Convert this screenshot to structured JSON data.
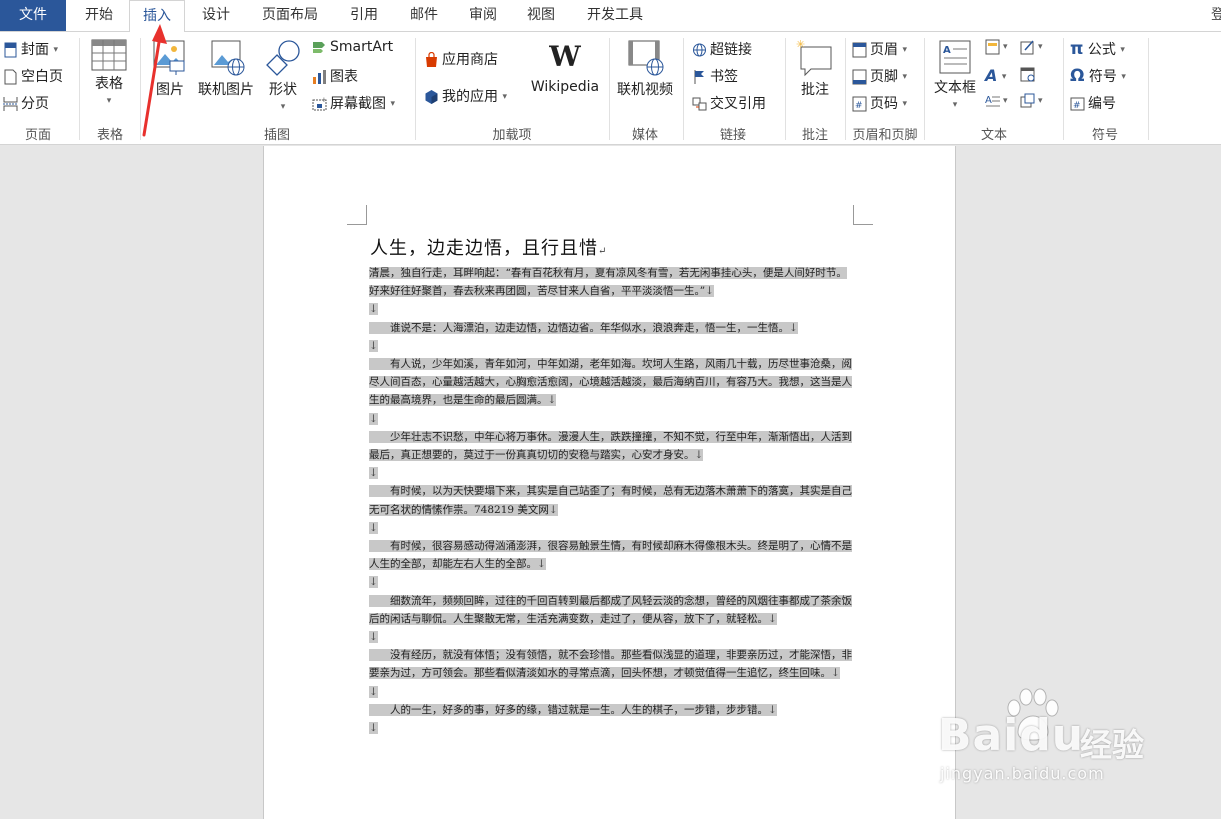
{
  "colors": {
    "accent": "#2b579a",
    "highlight": "#c8c8c8",
    "annotation": "#e8312d"
  },
  "tabs": [
    {
      "label": "文件"
    },
    {
      "label": "开始"
    },
    {
      "label": "插入"
    },
    {
      "label": "设计"
    },
    {
      "label": "页面布局"
    },
    {
      "label": "引用"
    },
    {
      "label": "邮件"
    },
    {
      "label": "审阅"
    },
    {
      "label": "视图"
    },
    {
      "label": "开发工具"
    }
  ],
  "account_label": "登",
  "ribbon": {
    "pages": {
      "cover": "封面",
      "blank_page": "空白页",
      "page_break": "分页",
      "group": "页面"
    },
    "tables": {
      "table": "表格",
      "group": "表格"
    },
    "illustrations": {
      "picture": "图片",
      "online_picture": "联机图片",
      "shapes": "形状",
      "smartart": "SmartArt",
      "chart": "图表",
      "screenshot": "屏幕截图",
      "group": "插图"
    },
    "addins": {
      "store": "应用商店",
      "my_apps": "我的应用",
      "wikipedia": "Wikipedia",
      "group": "加载项"
    },
    "media": {
      "online_video": "联机视频",
      "group": "媒体"
    },
    "links": {
      "hyperlink": "超链接",
      "bookmark": "书签",
      "cross_reference": "交叉引用",
      "group": "链接"
    },
    "comments": {
      "comment": "批注",
      "group": "批注"
    },
    "header_footer": {
      "header": "页眉",
      "footer": "页脚",
      "page_number": "页码",
      "group": "页眉和页脚"
    },
    "text": {
      "text_box": "文本框",
      "group": "文本"
    },
    "symbols": {
      "equation": "公式",
      "symbol": "符号",
      "number": "编号",
      "group": "符号"
    }
  },
  "document": {
    "title": "人生，边走边悟，且行且惜",
    "paragraph_mark": "↵",
    "line_break_mark": "↓",
    "paragraphs": [
      "清晨，独自行走，耳畔响起：“春有百花秋有月，夏有凉风冬有雪，若无闲事挂心头，便是人间好时节。好来好往好聚首，春去秋来再团圆，苦尽甘来人自省，平平淡淡悟一生。”",
      "",
      "　　谁说不是：人海漂泊，边走边悟，边悟边省。年华似水，浪浪奔走，悟一生，一生悟。",
      "",
      "　　有人说，少年如溪，青年如河，中年如湖，老年如海。坎坷人生路，风雨几十载，历尽世事沧桑，阅尽人间百态，心量越活越大，心胸愈活愈阔，心境越活越淡，最后海纳百川，有容乃大。我想，这当是人生的最高境界，也是生命的最后圆满。",
      "",
      "　　少年壮志不识愁，中年心将万事休。漫漫人生，跌跌撞撞，不知不觉，行至中年，渐渐悟出，人活到最后，真正想要的，莫过于一份真真切切的安稳与踏实，心安才身安。",
      "",
      "　　有时候，以为天快要塌下来，其实是自己站歪了；有时候，总有无边落木萧萧下的落寞，其实是自己无可名状的情愫作祟。748219 美文网",
      "",
      "　　有时候，很容易感动得汹涌澎湃，很容易触景生情，有时候却麻木得像根木头。终是明了，心情不是人生的全部，却能左右人生的全部。",
      "",
      "　　细数流年，频频回眸，过往的千回百转到最后都成了风轻云淡的念想，曾经的风烟往事都成了茶余饭后的闲话与聊侃。人生聚散无常，生活充满变数，走过了，便从容，放下了，就轻松。",
      "",
      "　　没有经历，就没有体悟；没有领悟，就不会珍惜。那些看似浅显的道理，非要亲历过，才能深悟，非要亲为过，方可领会。那些看似清淡如水的寻常点滴，回头怀想，才顿觉值得一生追忆，终生回味。",
      "",
      "　　人的一生，好多的事，好多的缘，错过就是一生。人生的棋子，一步错，步步错。",
      ""
    ]
  },
  "watermark": {
    "brand": "Baidu",
    "text": "经验",
    "url": "jingyan.baidu.com"
  }
}
